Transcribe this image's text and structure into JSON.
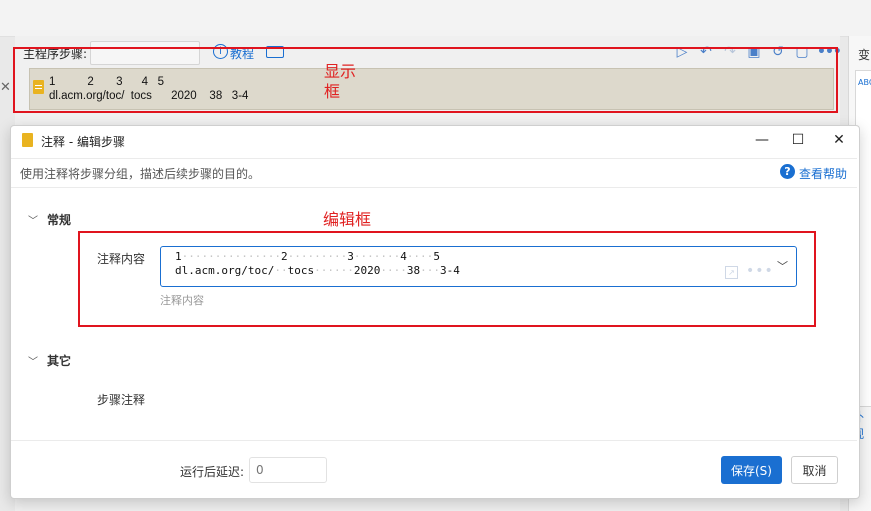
{
  "background": {
    "main_label": "主程序步骤:",
    "tutorial_label": "教程",
    "right_panel_title": "变",
    "right_panel_abc": "ABC",
    "right_panel_bottom": "补观",
    "step_text_line1": "1          2       3      4   5",
    "step_text_line2": "dl.acm.org/toc/  tocs      2020    38   3-4"
  },
  "annotations": {
    "display_label": "显示\n框",
    "edit_label": "编辑框"
  },
  "dialog": {
    "title": "注释  -  编辑步骤",
    "description": "使用注释将步骤分组，描述后续步骤的目的。",
    "help_label": "查看帮助",
    "section_general": "常规",
    "field_label": "注释内容",
    "editor_line1": [
      "1",
      "2",
      "3",
      "4",
      "5"
    ],
    "editor_line2": [
      "dl.acm.org/toc/",
      "tocs",
      "2020",
      "38",
      "3-4"
    ],
    "hint": "注释内容",
    "section_other": "其它",
    "step_note_label": "步骤注释",
    "delay_label": "运行后延迟:",
    "delay_placeholder": "0",
    "save_label": "保存(S)",
    "cancel_label": "取消"
  },
  "colors": {
    "accent": "#1a6fd1",
    "annotation_red": "#e0141e",
    "step_box_bg": "#ddd9cc",
    "doc_icon": "#e9b320"
  }
}
